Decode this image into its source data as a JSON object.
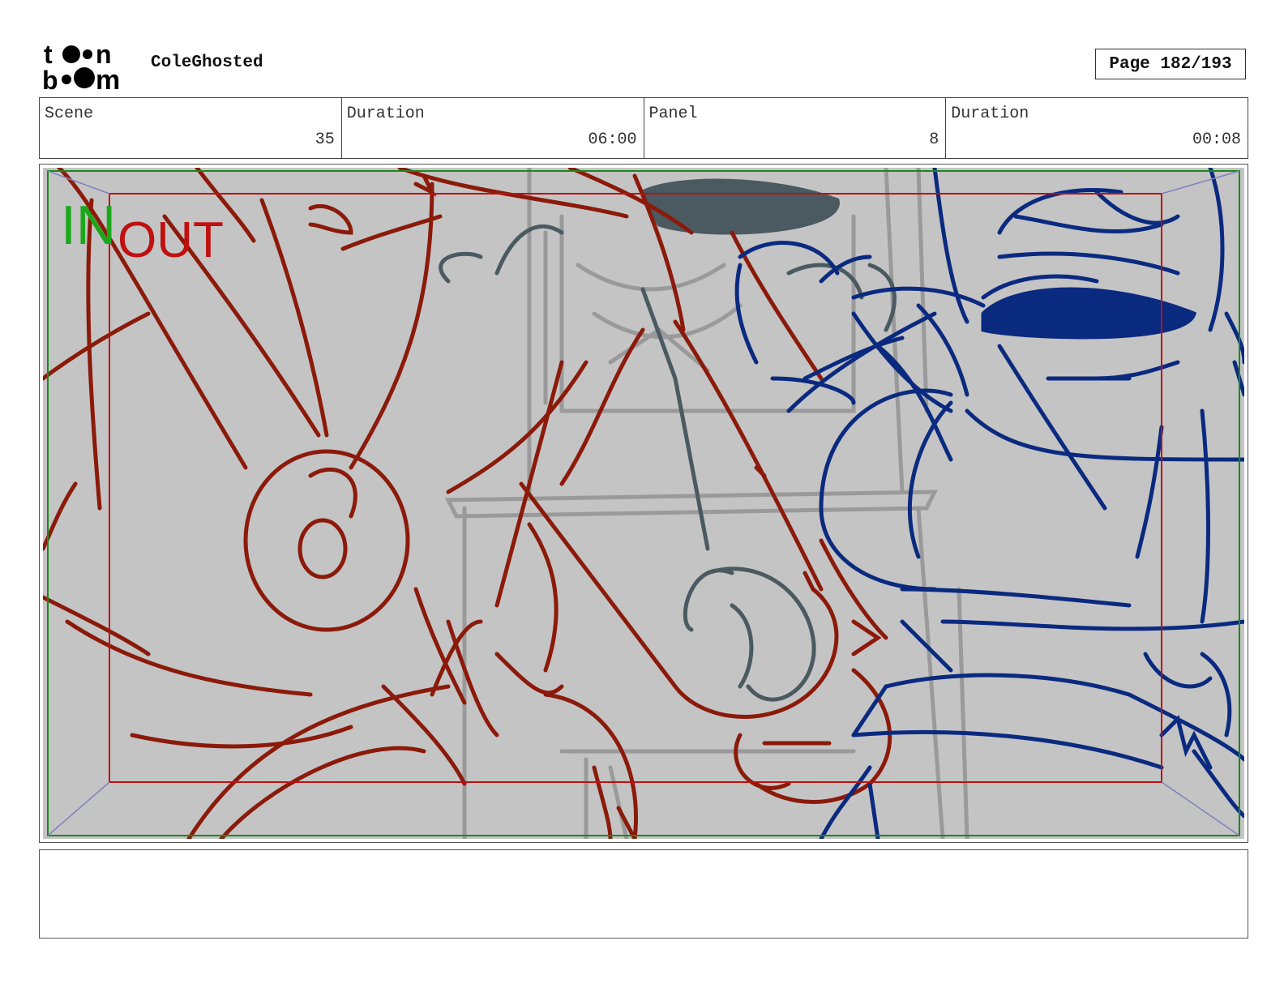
{
  "header": {
    "logo_text": "toon boom",
    "project_title": "ColeGhosted",
    "page_label": "Page 182/193"
  },
  "info": {
    "scene_label": "Scene",
    "scene_value": "35",
    "scene_duration_label": "Duration",
    "scene_duration_value": "06:00",
    "panel_label": "Panel",
    "panel_value": "8",
    "panel_duration_label": "Duration",
    "panel_duration_value": "00:08"
  },
  "panel": {
    "in_label": "IN",
    "out_label": "OUT",
    "colors": {
      "background": "#c4c4c4",
      "sketch_red": "#8b1a0a",
      "sketch_blue": "#0a2a80",
      "sketch_grey": "#4a5a60",
      "in_frame": "#1a8a1a",
      "out_frame": "#c01010"
    }
  },
  "notes": {
    "text": ""
  }
}
